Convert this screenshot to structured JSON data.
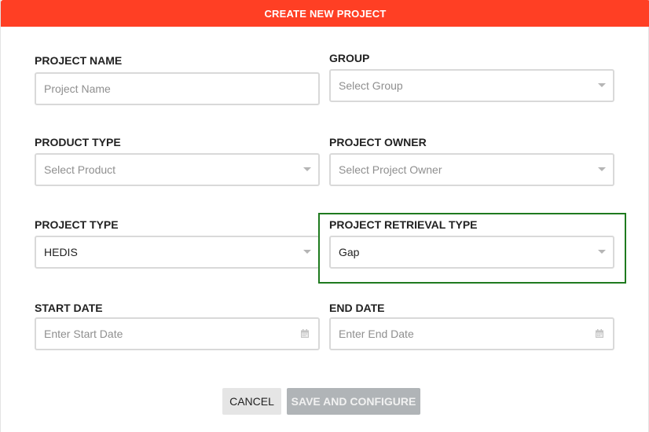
{
  "dialog": {
    "title": "CREATE NEW PROJECT"
  },
  "form": {
    "project_name": {
      "label": "PROJECT NAME",
      "placeholder": "Project Name",
      "value": ""
    },
    "group": {
      "label": "GROUP",
      "placeholder": "Select Group",
      "value": ""
    },
    "product_type": {
      "label": "PRODUCT TYPE",
      "placeholder": "Select Product",
      "value": ""
    },
    "project_owner": {
      "label": "PROJECT OWNER",
      "placeholder": "Select Project Owner",
      "value": ""
    },
    "project_type": {
      "label": "PROJECT TYPE",
      "value": "HEDIS"
    },
    "project_retrieval_type": {
      "label": "PROJECT RETRIEVAL TYPE",
      "value": "Gap"
    },
    "start_date": {
      "label": "START DATE",
      "placeholder": "Enter Start Date",
      "value": ""
    },
    "end_date": {
      "label": "END DATE",
      "placeholder": "Enter End Date",
      "value": ""
    }
  },
  "buttons": {
    "cancel": "CANCEL",
    "save_and_configure": "SAVE AND CONFIGURE"
  },
  "icons": {
    "dropdown": "chevron-down-icon",
    "date": "calendar-icon"
  },
  "colors": {
    "header": "#ff3f24",
    "highlight_border": "#1f7a1f",
    "disabled_button": "#b0b4b7"
  }
}
